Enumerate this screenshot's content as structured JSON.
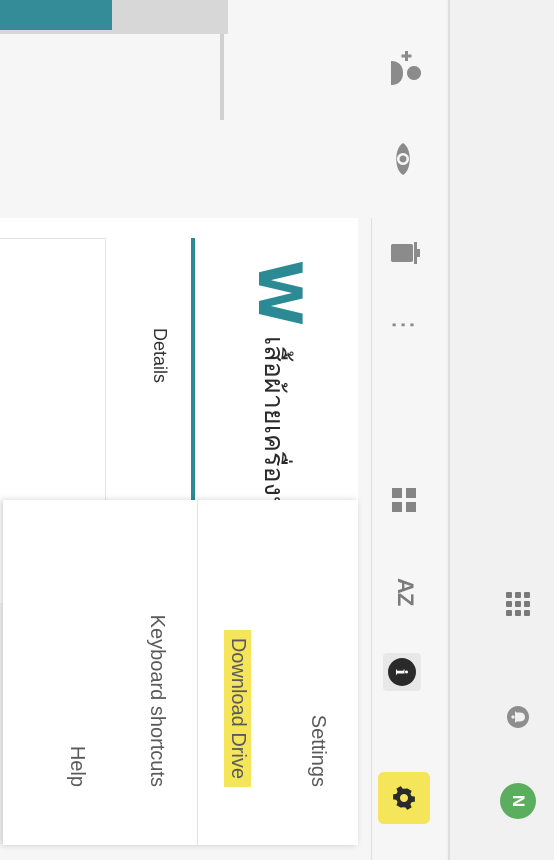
{
  "header": {
    "avatar_letter": "N",
    "icons": [
      "avatar",
      "bell-icon",
      "apps-grid-icon"
    ]
  },
  "toolbar": {
    "icons": [
      "share-person-icon",
      "eye-icon",
      "trash-icon",
      "more-vertical-icon",
      "grid-view-icon",
      "sort-az-icon",
      "info-icon",
      "gear-icon"
    ],
    "sort_label": "AZ",
    "info_label": "i"
  },
  "file": {
    "type_letter": "W",
    "title": "เสื้อผ้ายเครื่องป",
    "tab_label": "Details"
  },
  "settings_menu": {
    "items": [
      {
        "label": "Settings"
      },
      {
        "label": "Download Drive"
      },
      {
        "label": "Keyboard shortcuts"
      },
      {
        "label": "Help"
      }
    ]
  },
  "colors": {
    "highlight": "#f4e55a",
    "accent_teal": "#2c8a94",
    "avatar_green": "#5cae5f"
  }
}
